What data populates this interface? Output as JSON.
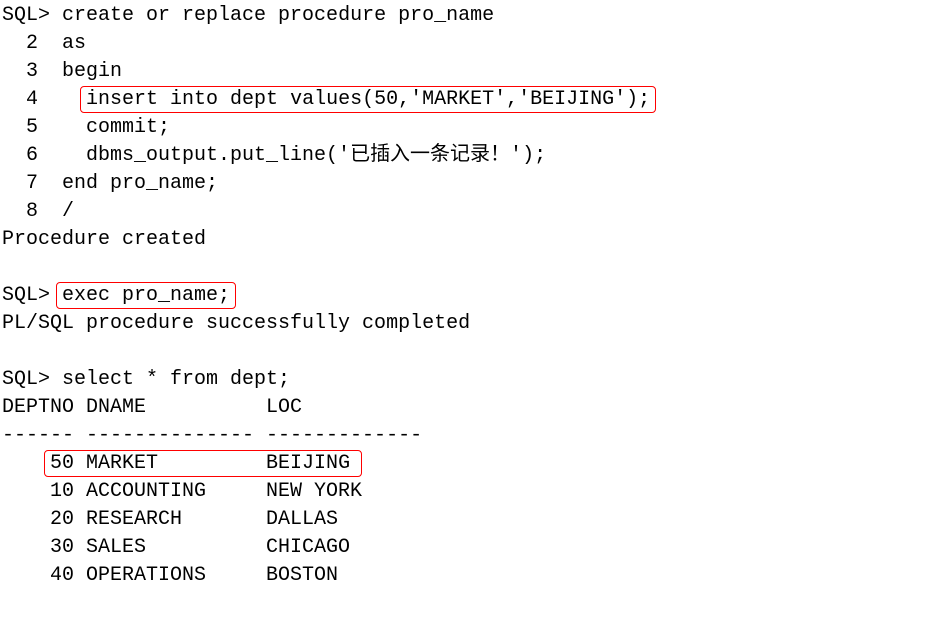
{
  "code": {
    "l1_prompt": "SQL>",
    "l1_text": " create or replace procedure pro_name",
    "l2_num": "  2  ",
    "l2_text": "as",
    "l3_num": "  3  ",
    "l3_text": "begin",
    "l4_num": "  4  ",
    "l4_pad": "  ",
    "l4_text": "insert into dept values(50,'MARKET','BEIJING');",
    "l5_num": "  5  ",
    "l5_text": "  commit;",
    "l6_num": "  6  ",
    "l6_text": "  dbms_output.put_line('已插入一条记录！');",
    "l7_num": "  7  ",
    "l7_text": "end pro_name;",
    "l8_num": "  8  ",
    "l8_text": "/",
    "created": "Procedure created",
    "blank": " ",
    "exec_prompt": "SQL>",
    "exec_pad": " ",
    "exec_text": "exec pro_name;",
    "completed": "PL/SQL procedure successfully completed",
    "sel_prompt": "SQL>",
    "sel_text": " select * from dept;",
    "header": "DEPTNO DNAME          LOC",
    "divider": "------ -------------- -------------",
    "r1_pad": "    ",
    "r1_text": "50 MARKET         BEIJING",
    "r2": "    10 ACCOUNTING     NEW YORK",
    "r3": "    20 RESEARCH       DALLAS",
    "r4": "    30 SALES          CHICAGO",
    "r5": "    40 OPERATIONS     BOSTON"
  },
  "chart_data": {
    "type": "table",
    "columns": [
      "DEPTNO",
      "DNAME",
      "LOC"
    ],
    "rows": [
      {
        "DEPTNO": 50,
        "DNAME": "MARKET",
        "LOC": "BEIJING"
      },
      {
        "DEPTNO": 10,
        "DNAME": "ACCOUNTING",
        "LOC": "NEW YORK"
      },
      {
        "DEPTNO": 20,
        "DNAME": "RESEARCH",
        "LOC": "DALLAS"
      },
      {
        "DEPTNO": 30,
        "DNAME": "SALES",
        "LOC": "CHICAGO"
      },
      {
        "DEPTNO": 40,
        "DNAME": "OPERATIONS",
        "LOC": "BOSTON"
      }
    ]
  }
}
